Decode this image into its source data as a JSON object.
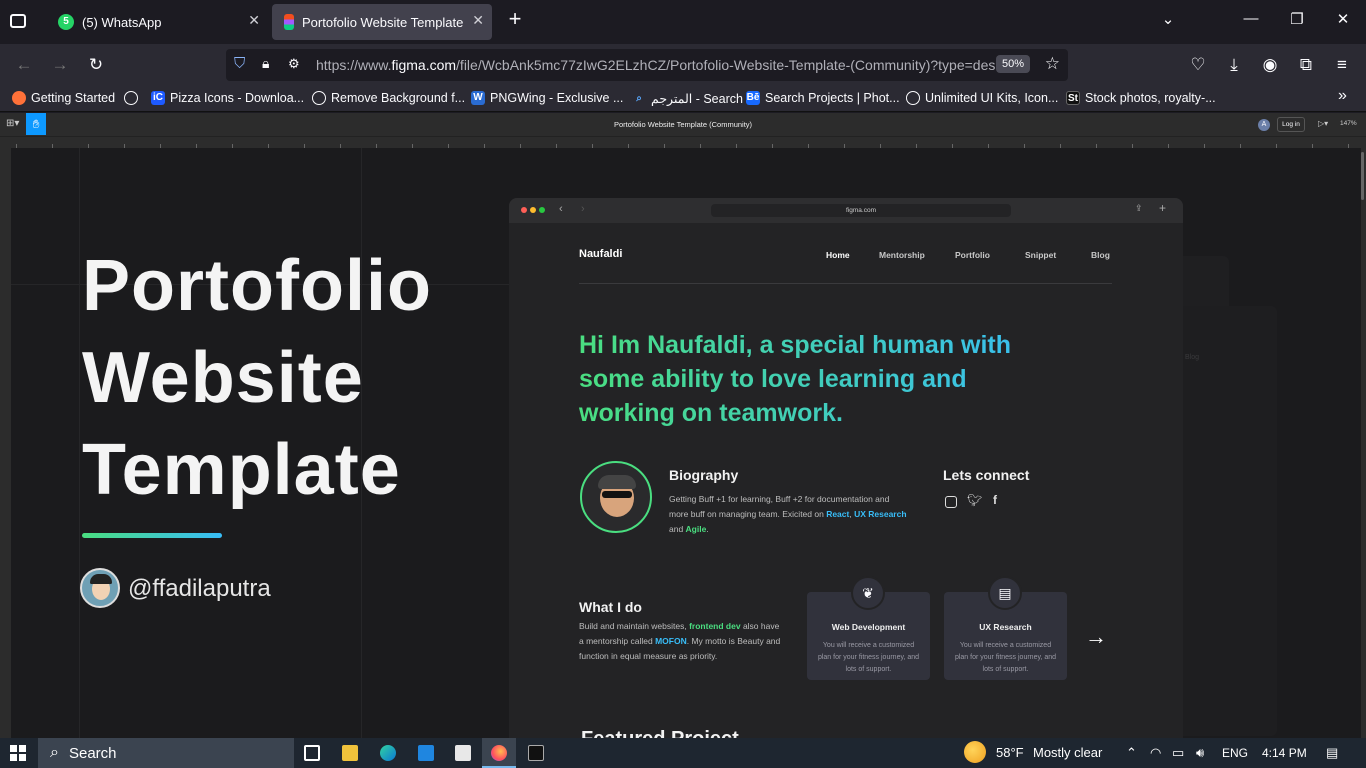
{
  "browser": {
    "tabs": [
      {
        "title": "(5) WhatsApp",
        "badge": "5"
      },
      {
        "title": "Portofolio Website Template (C"
      }
    ],
    "url_pre": "https://www.",
    "url_domain": "figma.com",
    "url_rest": "/file/WcbAnk5mc77zIwG2ELzhCZ/Portofolio-Website-Template-(Community)?type=des",
    "zoom": "50%",
    "bookmarks": [
      "Getting Started",
      "Pizza Icons - Downloa...",
      "Remove Background f...",
      "PNGWing - Exclusive ...",
      "المترجم - Search",
      "Search Projects | Phot...",
      "Unlimited UI Kits, Icon...",
      "Stock photos, royalty-..."
    ]
  },
  "figma": {
    "file_title": "Portofolio Website Template (Community)",
    "login": "Log in",
    "zoom": "147%",
    "avatar_letter": "A",
    "hero_line1": "Portofolio",
    "hero_line2": "Website",
    "hero_line3": "Template",
    "handle": "@ffadilaputra"
  },
  "mockup": {
    "address": "figma.com",
    "brand": "Naufaldi",
    "nav": [
      "Home",
      "Mentorship",
      "Portfolio",
      "Snippet",
      "Blog"
    ],
    "headline": "Hi Im Naufaldi, a special human with some ability to love learning and working on teamwork.",
    "bio_title": "Biography",
    "bio_text_1": "Getting Buff +1 for learning, Buff +2 for documentation and more buff on managing team. Exicited on ",
    "bio_link_1": "React",
    "bio_sep": ", ",
    "bio_link_2": "UX Research",
    "bio_and": " and ",
    "bio_link_3": "Agile",
    "bio_end": ".",
    "connect_title": "Lets connect",
    "whatido_title": "What I do",
    "whatido_1": "Build and maintain websites, ",
    "whatido_link1": "frontend dev",
    "whatido_2": " also have a mentorship called ",
    "whatido_link2": "MOFON",
    "whatido_3": ". My motto is Beauty and function in equal measure as priority.",
    "cards": [
      {
        "title": "Web Development",
        "desc": "You will receive a customized plan for your fitness journey, and lots of support."
      },
      {
        "title": "UX Research",
        "desc": "You will receive a customized plan for your fitness journey, and lots of support."
      }
    ],
    "featured": "Featured Project",
    "ghost_blog": "Blog"
  },
  "taskbar": {
    "search": "Search",
    "temp": "58°F",
    "weather": "Mostly clear",
    "lang": "ENG",
    "time": "4:14 PM"
  },
  "colors": {
    "accent_green": "#4ade80",
    "accent_blue": "#38bdf8"
  }
}
